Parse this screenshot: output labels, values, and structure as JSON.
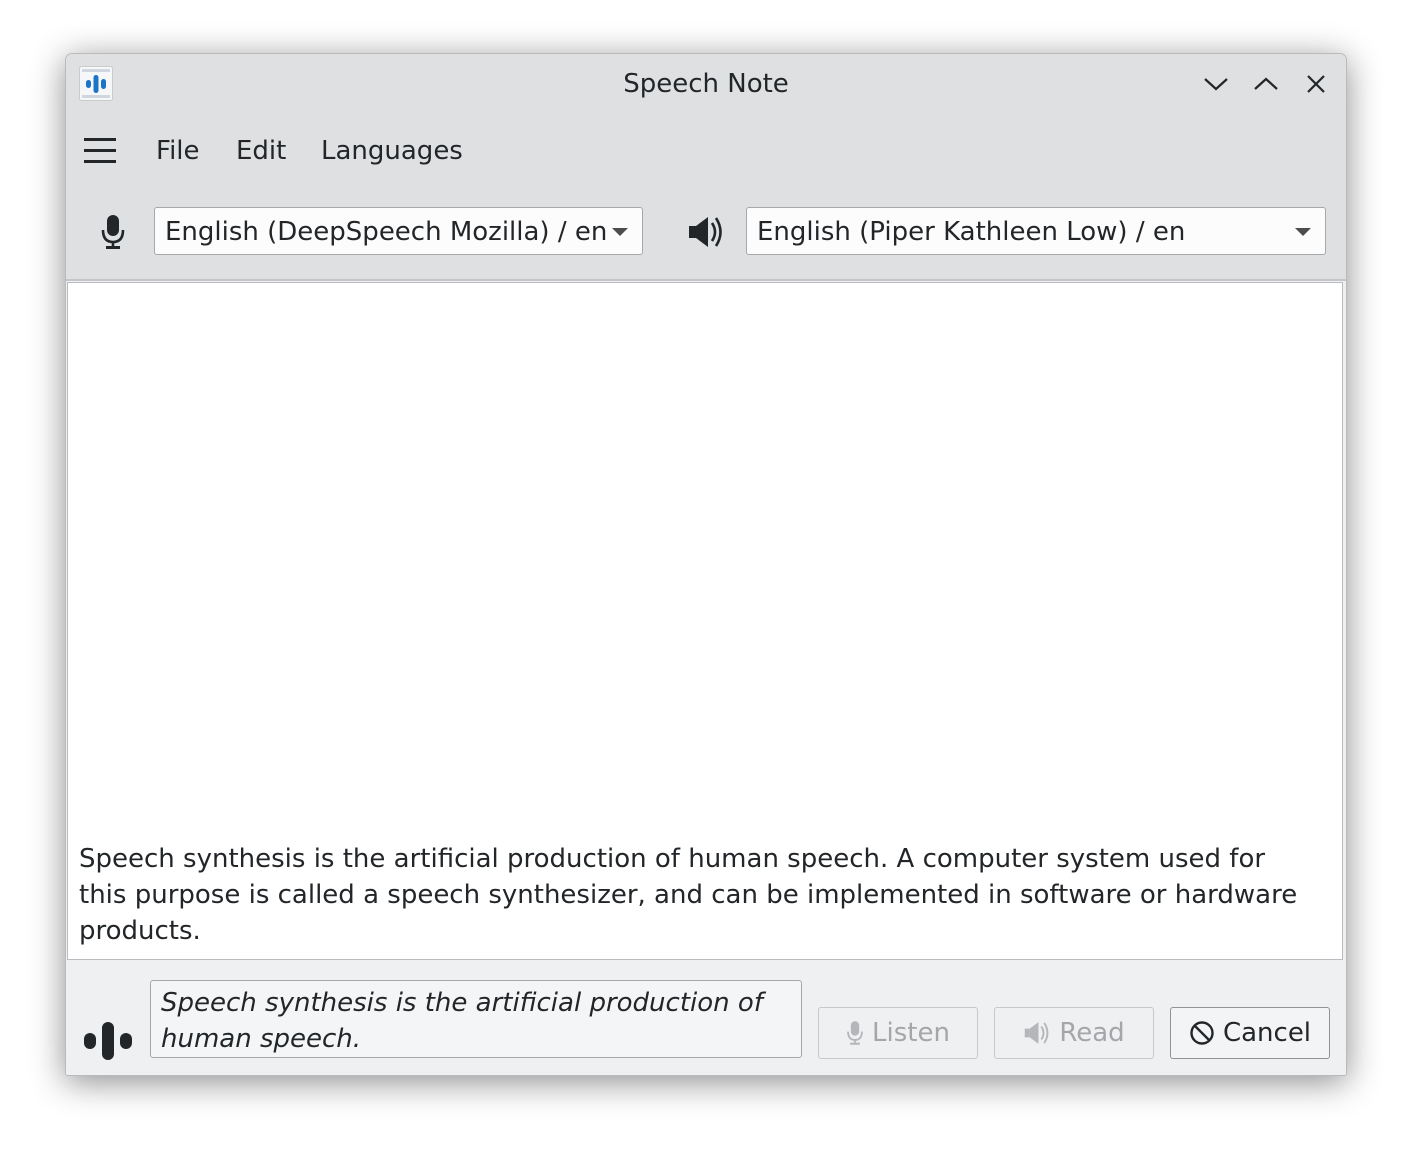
{
  "window": {
    "title": "Speech Note"
  },
  "menu": {
    "items": [
      "File",
      "Edit",
      "Languages"
    ]
  },
  "stt": {
    "icon": "microphone-icon",
    "selected": "English (DeepSpeech Mozilla) / en"
  },
  "tts": {
    "icon": "speaker-icon",
    "selected": "English (Piper Kathleen Low) / en"
  },
  "editor": {
    "text": "Speech synthesis is the artificial production of human speech. A computer system used for this purpose is called a speech synthesizer, and can be implemented in software or hardware products."
  },
  "status": {
    "icon": "audio-level-icon",
    "text": "Speech synthesis is the artificial production of human speech."
  },
  "buttons": {
    "listen": {
      "label": "Listen",
      "enabled": false
    },
    "read": {
      "label": "Read",
      "enabled": false
    },
    "cancel": {
      "label": "Cancel",
      "enabled": true
    }
  },
  "colors": {
    "accent": "#1d74c6",
    "background": "#eff0f1",
    "titlebar": "#dee0e2"
  }
}
